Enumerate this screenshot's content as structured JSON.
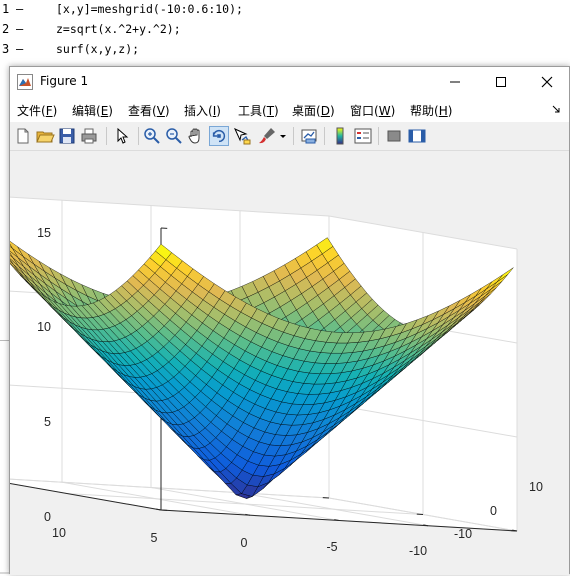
{
  "editor": {
    "lines": [
      {
        "num": "1",
        "dash": "–",
        "code": "[x,y]=meshgrid(-10:0.6:10);"
      },
      {
        "num": "2",
        "dash": "–",
        "code": "z=sqrt(x.^2+y.^2);"
      },
      {
        "num": "3",
        "dash": "–",
        "code": "surf(x,y,z);"
      }
    ]
  },
  "window": {
    "title": "Figure 1",
    "controls": {
      "minimize": "—",
      "maximize": "☐",
      "close": "✕"
    }
  },
  "menu": {
    "items": [
      {
        "label": "文件(",
        "key": "F",
        "end": ")"
      },
      {
        "label": "编辑(",
        "key": "E",
        "end": ")"
      },
      {
        "label": "查看(",
        "key": "V",
        "end": ")"
      },
      {
        "label": "插入(",
        "key": "I",
        "end": ")"
      },
      {
        "label": "工具(",
        "key": "T",
        "end": ")"
      },
      {
        "label": "桌面(",
        "key": "D",
        "end": ")"
      },
      {
        "label": "窗口(",
        "key": "W",
        "end": ")"
      },
      {
        "label": "帮助(",
        "key": "H",
        "end": ")"
      }
    ],
    "overflow_icon": "arrow-icon"
  },
  "toolbar": {
    "icons": [
      "new-figure-icon",
      "open-file-icon",
      "save-icon",
      "print-icon",
      "edit-plot-icon",
      "zoom-in-icon",
      "zoom-out-icon",
      "pan-icon",
      "rotate-3d-icon",
      "data-cursor-icon",
      "brush-icon",
      "brush-dropdown-icon",
      "link-plot-icon",
      "insert-colorbar-icon",
      "insert-legend-icon",
      "hide-plot-tools-icon",
      "show-plot-tools-icon"
    ]
  },
  "chart_data": {
    "type": "surface",
    "function": "z = sqrt(x.^2 + y.^2)",
    "x_range": [
      -10,
      10
    ],
    "y_range": [
      -10,
      10
    ],
    "step": 0.6,
    "z_range": [
      0,
      15
    ],
    "z_ticks": [
      "0",
      "5",
      "10",
      "15"
    ],
    "x_ticks": [
      "10",
      "5",
      "0",
      "-5",
      "-10"
    ],
    "y_ticks": [
      "-10",
      "0",
      "10"
    ],
    "colormap": "parula",
    "colors": {
      "low": "#352a87",
      "mid": "#21b5a2",
      "high": "#f9fb0e"
    },
    "grid": true,
    "title": "",
    "xlabel": "",
    "ylabel": "",
    "zlabel": ""
  }
}
